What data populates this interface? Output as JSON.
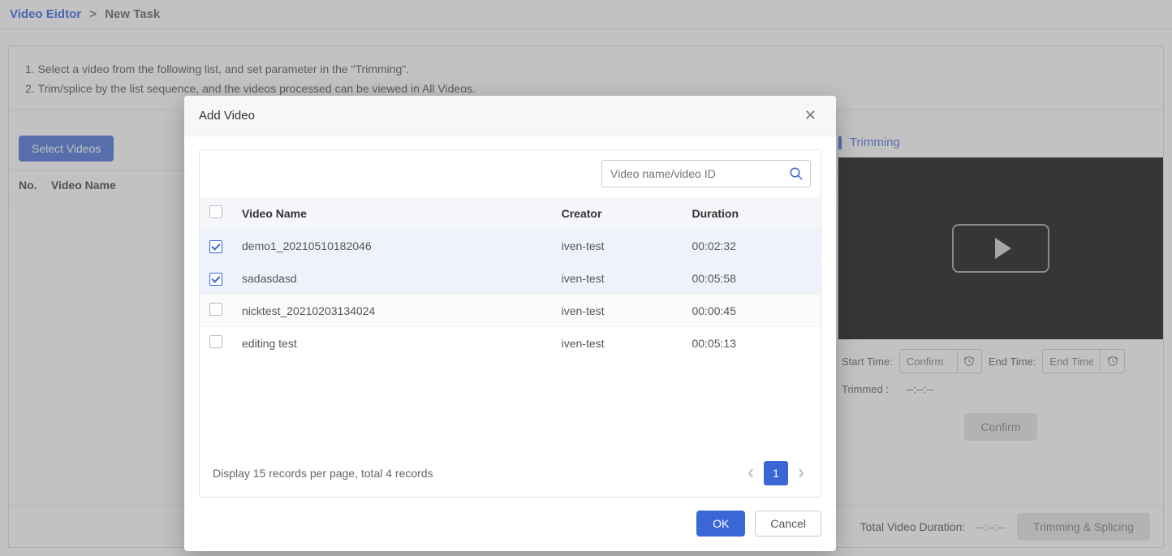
{
  "breadcrumb": {
    "link": "Video Eidtor",
    "sep": ">",
    "current": "New Task"
  },
  "instructions": {
    "line1": "Select a video from the following list, and set parameter in the \"Trimming\".",
    "line2": "Trim/splice by the list sequence, and the videos processed can be viewed in All Videos."
  },
  "left_pane": {
    "select_videos": "Select Videos",
    "col_no": "No.",
    "col_name": "Video Name"
  },
  "right_pane": {
    "title": "Trimming",
    "start_label": "Start Time:",
    "start_placeholder": "Confirm",
    "end_label": "End Time:",
    "end_placeholder": "End Time",
    "trimmed_label": "Trimmed :",
    "trimmed_value": "--:--:--",
    "confirm": "Confirm"
  },
  "bottom": {
    "total_label": "Total Video Duration:",
    "total_value": "--:--:--",
    "action": "Trimming & Splicing"
  },
  "modal": {
    "title": "Add Video",
    "search_placeholder": "Video name/video ID",
    "columns": {
      "name": "Video Name",
      "creator": "Creator",
      "duration": "Duration"
    },
    "rows": [
      {
        "checked": true,
        "name": "demo1_20210510182046",
        "creator": "iven-test",
        "duration": "00:02:32"
      },
      {
        "checked": true,
        "name": "sadasdasd",
        "creator": "iven-test",
        "duration": "00:05:58"
      },
      {
        "checked": false,
        "name": "nicktest_20210203134024",
        "creator": "iven-test",
        "duration": "00:00:45"
      },
      {
        "checked": false,
        "name": "editing test",
        "creator": "iven-test",
        "duration": "00:05:13"
      }
    ],
    "records_line": "Display 15 records per page, total 4 records",
    "page": "1",
    "ok": "OK",
    "cancel": "Cancel"
  }
}
